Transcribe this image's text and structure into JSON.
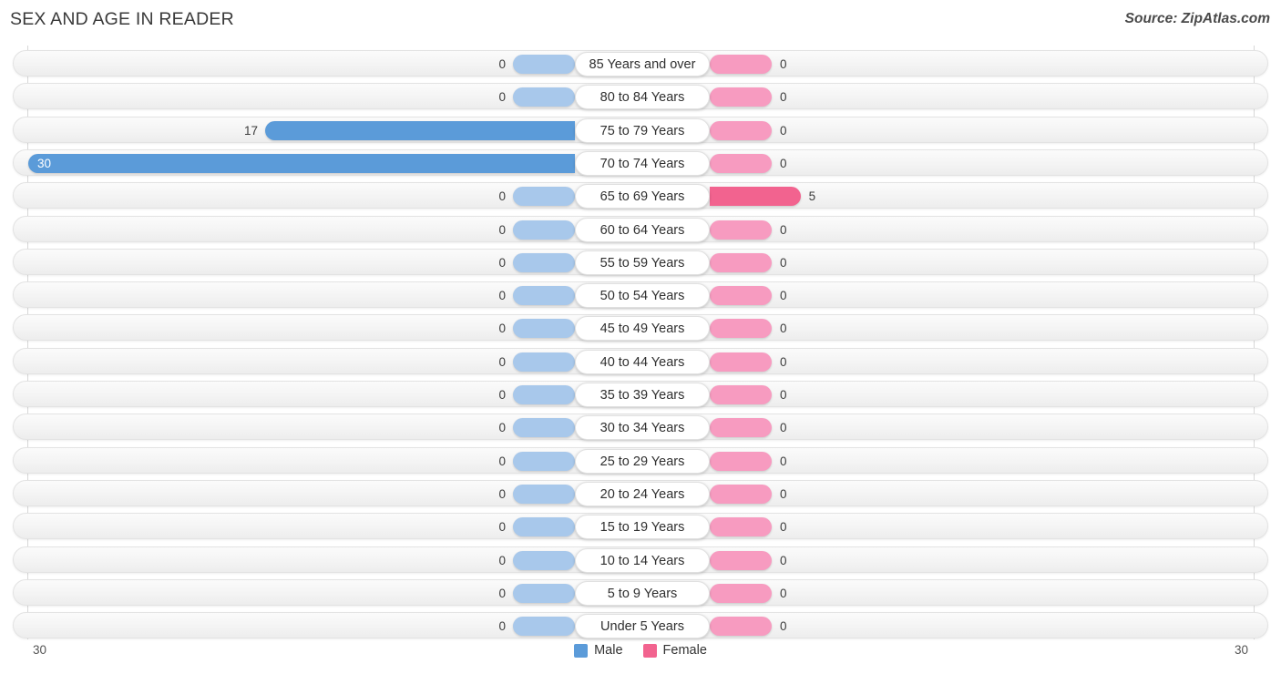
{
  "header": {
    "title": "SEX AND AGE IN READER",
    "source": "Source: ZipAtlas.com"
  },
  "legend": {
    "male_label": "Male",
    "female_label": "Female",
    "male_color": "#5B9BD9",
    "female_color": "#F2638F"
  },
  "axis": {
    "left_tick": "30",
    "right_tick": "30"
  },
  "colors": {
    "male_strong": "#5B9BD9",
    "male_zero": "#A8C8EB",
    "female_strong": "#F2638F",
    "female_zero": "#F79BC0"
  },
  "chart_data": {
    "type": "bar",
    "title": "SEX AND AGE IN READER",
    "xlabel": "",
    "ylabel": "",
    "xlim": [
      30,
      30
    ],
    "grid": false,
    "legend_position": "bottom",
    "categories": [
      "85 Years and over",
      "80 to 84 Years",
      "75 to 79 Years",
      "70 to 74 Years",
      "65 to 69 Years",
      "60 to 64 Years",
      "55 to 59 Years",
      "50 to 54 Years",
      "45 to 49 Years",
      "40 to 44 Years",
      "35 to 39 Years",
      "30 to 34 Years",
      "25 to 29 Years",
      "20 to 24 Years",
      "15 to 19 Years",
      "10 to 14 Years",
      "5 to 9 Years",
      "Under 5 Years"
    ],
    "series": [
      {
        "name": "Male",
        "values": [
          0,
          0,
          17,
          30,
          0,
          0,
          0,
          0,
          0,
          0,
          0,
          0,
          0,
          0,
          0,
          0,
          0,
          0
        ]
      },
      {
        "name": "Female",
        "values": [
          0,
          0,
          0,
          0,
          5,
          0,
          0,
          0,
          0,
          0,
          0,
          0,
          0,
          0,
          0,
          0,
          0,
          0
        ]
      }
    ],
    "rows": [
      {
        "age": "85 Years and over",
        "male": 0,
        "male_label": "0",
        "female": 0,
        "female_label": "0"
      },
      {
        "age": "80 to 84 Years",
        "male": 0,
        "male_label": "0",
        "female": 0,
        "female_label": "0"
      },
      {
        "age": "75 to 79 Years",
        "male": 17,
        "male_label": "17",
        "female": 0,
        "female_label": "0"
      },
      {
        "age": "70 to 74 Years",
        "male": 30,
        "male_label": "30",
        "female": 0,
        "female_label": "0"
      },
      {
        "age": "65 to 69 Years",
        "male": 0,
        "male_label": "0",
        "female": 5,
        "female_label": "5"
      },
      {
        "age": "60 to 64 Years",
        "male": 0,
        "male_label": "0",
        "female": 0,
        "female_label": "0"
      },
      {
        "age": "55 to 59 Years",
        "male": 0,
        "male_label": "0",
        "female": 0,
        "female_label": "0"
      },
      {
        "age": "50 to 54 Years",
        "male": 0,
        "male_label": "0",
        "female": 0,
        "female_label": "0"
      },
      {
        "age": "45 to 49 Years",
        "male": 0,
        "male_label": "0",
        "female": 0,
        "female_label": "0"
      },
      {
        "age": "40 to 44 Years",
        "male": 0,
        "male_label": "0",
        "female": 0,
        "female_label": "0"
      },
      {
        "age": "35 to 39 Years",
        "male": 0,
        "male_label": "0",
        "female": 0,
        "female_label": "0"
      },
      {
        "age": "30 to 34 Years",
        "male": 0,
        "male_label": "0",
        "female": 0,
        "female_label": "0"
      },
      {
        "age": "25 to 29 Years",
        "male": 0,
        "male_label": "0",
        "female": 0,
        "female_label": "0"
      },
      {
        "age": "20 to 24 Years",
        "male": 0,
        "male_label": "0",
        "female": 0,
        "female_label": "0"
      },
      {
        "age": "15 to 19 Years",
        "male": 0,
        "male_label": "0",
        "female": 0,
        "female_label": "0"
      },
      {
        "age": "10 to 14 Years",
        "male": 0,
        "male_label": "0",
        "female": 0,
        "female_label": "0"
      },
      {
        "age": "5 to 9 Years",
        "male": 0,
        "male_label": "0",
        "female": 0,
        "female_label": "0"
      },
      {
        "age": "Under 5 Years",
        "male": 0,
        "male_label": "0",
        "female": 0,
        "female_label": "0"
      }
    ]
  }
}
